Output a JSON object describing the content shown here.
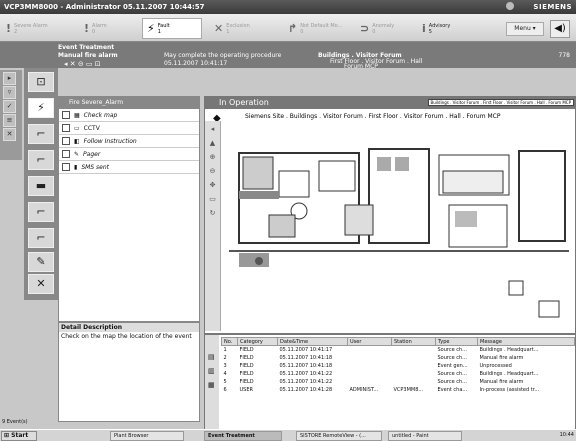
{
  "window": {
    "title": "VCP3MM8000 - Administrator   05.11.2007 10:44:57",
    "brand": "SIEMENS"
  },
  "alarmbar": {
    "buttons": [
      {
        "label": "Severe Alarm",
        "count": "2",
        "icon": "severe-alarm-icon",
        "glyph": "!",
        "active": false
      },
      {
        "label": "Alarm",
        "count": "0",
        "icon": "alarm-icon",
        "glyph": "!",
        "active": false
      },
      {
        "label": "Fault",
        "count": "1",
        "icon": "fault-icon",
        "glyph": "⚡",
        "active": true
      },
      {
        "label": "Exclusion",
        "count": "1",
        "icon": "exclusion-icon",
        "glyph": "✕",
        "active": false
      },
      {
        "label": "Not Default Mo...",
        "count": "0",
        "icon": "not-default-icon",
        "glyph": "↱",
        "active": false
      },
      {
        "label": "Anomaly",
        "count": "0",
        "icon": "anomaly-icon",
        "glyph": "⊃",
        "active": false
      },
      {
        "label": "Advisory",
        "count": "5",
        "icon": "advisory-icon",
        "glyph": "i",
        "active": false
      }
    ],
    "menu_label": "Menu  ▾"
  },
  "event_treatment": {
    "section_label": "Event Treatment",
    "event_name": "Manual fire alarm",
    "instruction": "May complete the operating procedure",
    "datetime": "05.11.2007  10:41:17",
    "location_title": "Buildings . Visitor Forum",
    "location_line2": "First Floor . Visitor Forum . Hall",
    "location_line3": "Forum MCP",
    "number": "778"
  },
  "procedure": {
    "header": "Fire Severe_Alarm",
    "steps": [
      {
        "label": "Check map",
        "icon": "map-icon"
      },
      {
        "label": "CCTV",
        "icon": "cctv-icon"
      },
      {
        "label": "Follow Instruction",
        "icon": "instruction-icon"
      },
      {
        "label": "Pager",
        "icon": "pager-icon"
      },
      {
        "label": "SMS sent",
        "icon": "sms-icon"
      }
    ]
  },
  "detail": {
    "heading": "Detail Description",
    "text": "Check on the map the location of the event"
  },
  "map": {
    "status": "In Operation",
    "tooltip": "Buildings . Visitor Forum . First Floor . Visitor Forum . Hall . Forum MCP",
    "path": "Siemens Site . Buildings . Visitor Forum . First Floor . Visitor Forum . Hall . Forum MCP"
  },
  "events": {
    "columns": [
      "No.",
      "Category",
      "Date&Time",
      "User",
      "Station",
      "Type",
      "Message"
    ],
    "rows": [
      [
        "1",
        "FIELD",
        "05.11.2007 10:41:17",
        "",
        "",
        "Source ch...",
        "Buildings . Headquart..."
      ],
      [
        "2",
        "FIELD",
        "05.11.2007 10:41:18",
        "",
        "",
        "Source ch...",
        "Manual fire alarm"
      ],
      [
        "3",
        "FIELD",
        "05.11.2007 10:41:18",
        "",
        "",
        "Event gen...",
        "Unprocessed"
      ],
      [
        "4",
        "FIELD",
        "05.11.2007 10:41:22",
        "",
        "",
        "Source ch...",
        "Buildings . Headquart..."
      ],
      [
        "5",
        "FIELD",
        "05.11.2007 10:41:22",
        "",
        "",
        "Source ch...",
        "Manual fire alarm"
      ],
      [
        "6",
        "USER",
        "05.11.2007 10:41:28",
        "ADMINIST...",
        "VCP3MM8...",
        "Event cha...",
        "In-process (assisted tr..."
      ]
    ]
  },
  "status": {
    "events_count": "9 Event(s)"
  },
  "taskbar": {
    "start": "Start",
    "tasks": [
      "Plant Browser",
      "Event Treatment",
      "SISTORE RemoteView - (...",
      "untitled - Paint"
    ],
    "clock": "10:44"
  }
}
